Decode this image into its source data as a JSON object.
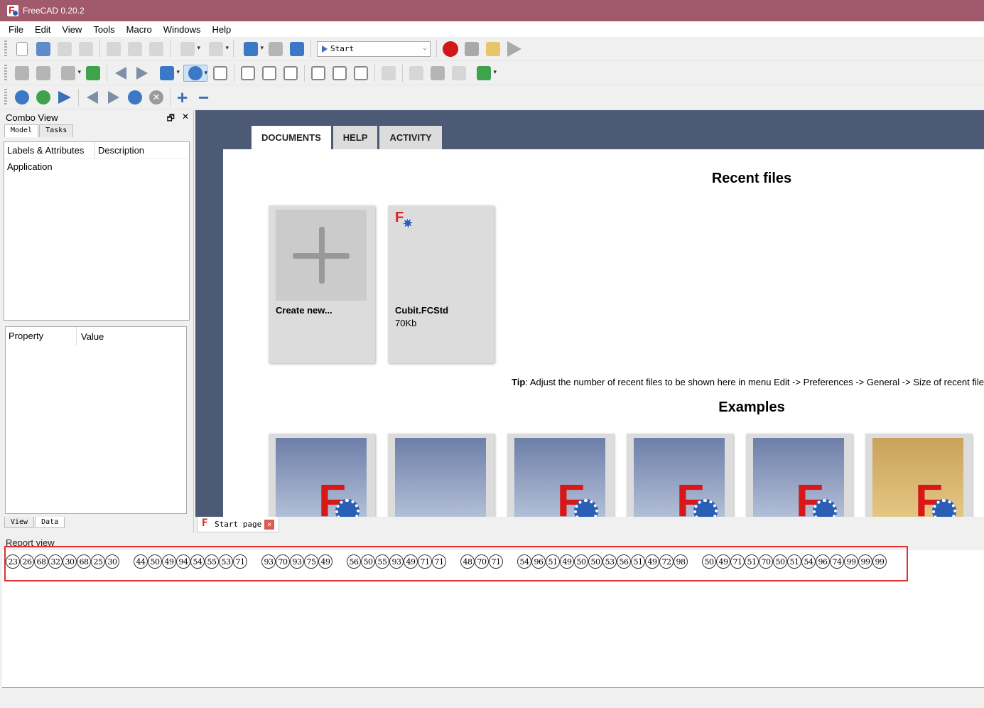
{
  "window": {
    "title": "FreeCAD 0.20.2",
    "accent": "#a05a6c"
  },
  "menu": [
    "File",
    "Edit",
    "View",
    "Tools",
    "Macro",
    "Windows",
    "Help"
  ],
  "workbench_selector": {
    "value": "Start"
  },
  "combo_view": {
    "title": "Combo View",
    "tabs": [
      "Model",
      "Tasks"
    ],
    "tree_columns": [
      "Labels & Attributes",
      "Description"
    ],
    "tree_rows": [
      "Application"
    ],
    "property_columns": [
      "Property",
      "Value"
    ],
    "bottom_tabs": [
      "View",
      "Data"
    ]
  },
  "start_page": {
    "tabs": [
      "DOCUMENTS",
      "HELP",
      "ACTIVITY"
    ],
    "recent_title": "Recent files",
    "create_new": "Create new...",
    "recent_files": [
      {
        "name": "Cubit.FCStd",
        "size": "70Kb"
      }
    ],
    "tip_label": "Tip",
    "tip_text": ": Adjust the number of recent files to be shown here in menu Edit -> Preferences -> General -> Size of recent file",
    "examples_title": "Examples"
  },
  "document_tab": {
    "label": "Start page"
  },
  "report_view": {
    "title": "Report view",
    "number_groups": [
      [
        "23",
        "26",
        "68",
        "32",
        "30",
        "68",
        "25",
        "30"
      ],
      [
        "44",
        "50",
        "49",
        "94",
        "54",
        "55",
        "53",
        "71"
      ],
      [
        "93",
        "70",
        "93",
        "75",
        "49"
      ],
      [
        "56",
        "50",
        "55",
        "93",
        "49",
        "71",
        "71"
      ],
      [
        "48",
        "70",
        "71"
      ],
      [
        "54",
        "96",
        "51",
        "49",
        "50",
        "50",
        "53",
        "56",
        "51",
        "49",
        "72",
        "98"
      ],
      [
        "50",
        "49",
        "71",
        "51",
        "70",
        "50",
        "51",
        "54",
        "96",
        "74",
        "99",
        "99",
        "99"
      ]
    ]
  }
}
